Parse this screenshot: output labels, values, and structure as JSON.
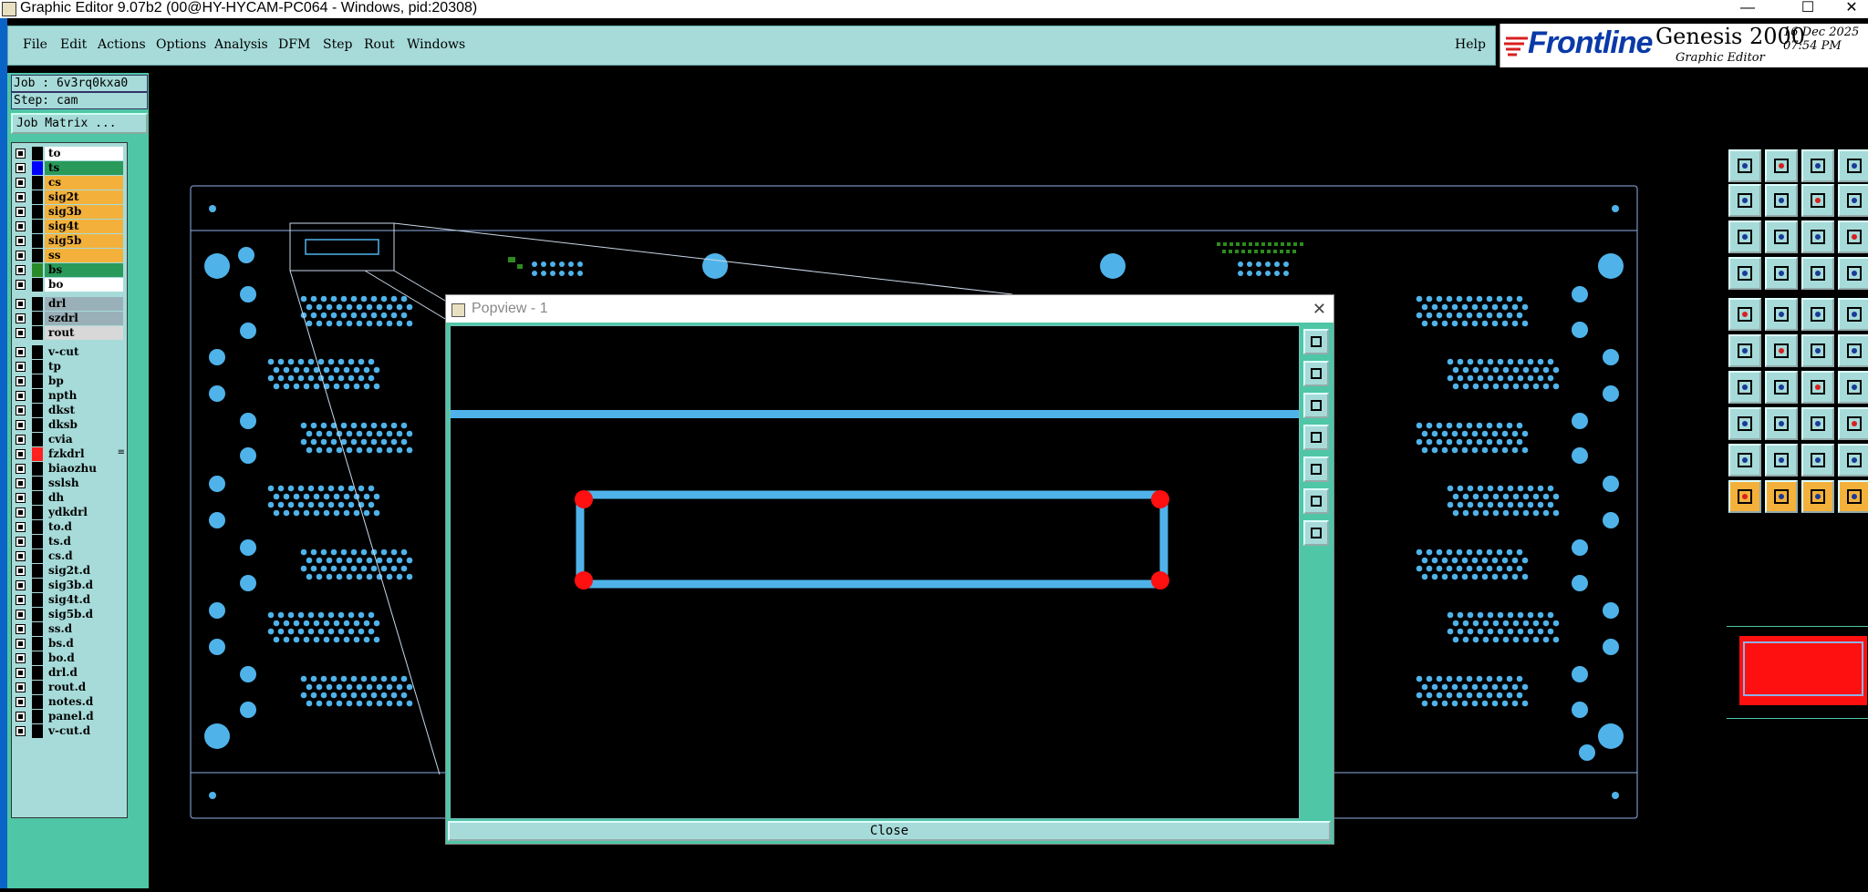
{
  "window": {
    "title": "Graphic Editor 9.07b2 (00@HY-HYCAM-PC064 - Windows, pid:20308)",
    "minimize": "—",
    "maximize": "☐",
    "close": "✕"
  },
  "menubar": {
    "items": [
      "File",
      "Edit",
      "Actions",
      "Options",
      "Analysis",
      "DFM",
      "Step",
      "Rout",
      "Windows"
    ],
    "help": "Help"
  },
  "logo": {
    "brand": "Frontline",
    "product": "Genesis 2000",
    "subtitle": "Graphic Editor",
    "date": "16 Dec 2025",
    "time": "07:54 PM"
  },
  "job": {
    "job_line": "Job : 6v3rq0kxa0",
    "step_line": "Step: cam",
    "matrix_button": "Job Matrix ..."
  },
  "layers": [
    {
      "name": "to",
      "swatch": "#000000",
      "bg": "#ffffff"
    },
    {
      "name": "ts",
      "swatch": "#0000ff",
      "bg": "#2a9a5a"
    },
    {
      "name": "cs",
      "swatch": "#000000",
      "bg": "#f3b13b"
    },
    {
      "name": "sig2t",
      "swatch": "#000000",
      "bg": "#f3b13b"
    },
    {
      "name": "sig3b",
      "swatch": "#000000",
      "bg": "#f3b13b"
    },
    {
      "name": "sig4t",
      "swatch": "#000000",
      "bg": "#f3b13b"
    },
    {
      "name": "sig5b",
      "swatch": "#000000",
      "bg": "#f3b13b"
    },
    {
      "name": "ss",
      "swatch": "#000000",
      "bg": "#f3b13b"
    },
    {
      "name": "bs",
      "swatch": "#2a8a2a",
      "bg": "#2a9a5a"
    },
    {
      "name": "bo",
      "swatch": "#000000",
      "bg": "#ffffff"
    },
    {
      "name": "drl",
      "swatch": "#000000",
      "bg": "#9ab0b8",
      "gap": true
    },
    {
      "name": "szdrl",
      "swatch": "#000000",
      "bg": "#9ab0b8"
    },
    {
      "name": "rout",
      "swatch": "#000000",
      "bg": "#d8d8d8"
    },
    {
      "name": "v-cut",
      "swatch": "#000000",
      "bg": "#a6dbd9",
      "gap": true
    },
    {
      "name": "tp",
      "swatch": "#000000",
      "bg": "#a6dbd9"
    },
    {
      "name": "bp",
      "swatch": "#000000",
      "bg": "#a6dbd9"
    },
    {
      "name": "npth",
      "swatch": "#000000",
      "bg": "#a6dbd9"
    },
    {
      "name": "dkst",
      "swatch": "#000000",
      "bg": "#a6dbd9"
    },
    {
      "name": "dksb",
      "swatch": "#000000",
      "bg": "#a6dbd9"
    },
    {
      "name": "cvia",
      "swatch": "#000000",
      "bg": "#a6dbd9"
    },
    {
      "name": "fzkdrl",
      "swatch": "#ff2020",
      "bg": "#a6dbd9",
      "mark": "≡"
    },
    {
      "name": "biaozhu",
      "swatch": "#000000",
      "bg": "#a6dbd9"
    },
    {
      "name": "sslsh",
      "swatch": "#000000",
      "bg": "#a6dbd9"
    },
    {
      "name": "dh",
      "swatch": "#000000",
      "bg": "#a6dbd9"
    },
    {
      "name": "ydkdrl",
      "swatch": "#000000",
      "bg": "#a6dbd9"
    },
    {
      "name": "to.d",
      "swatch": "#000000",
      "bg": "#a6dbd9"
    },
    {
      "name": "ts.d",
      "swatch": "#000000",
      "bg": "#a6dbd9"
    },
    {
      "name": "cs.d",
      "swatch": "#000000",
      "bg": "#a6dbd9"
    },
    {
      "name": "sig2t.d",
      "swatch": "#000000",
      "bg": "#a6dbd9"
    },
    {
      "name": "sig3b.d",
      "swatch": "#000000",
      "bg": "#a6dbd9"
    },
    {
      "name": "sig4t.d",
      "swatch": "#000000",
      "bg": "#a6dbd9"
    },
    {
      "name": "sig5b.d",
      "swatch": "#000000",
      "bg": "#a6dbd9"
    },
    {
      "name": "ss.d",
      "swatch": "#000000",
      "bg": "#a6dbd9"
    },
    {
      "name": "bs.d",
      "swatch": "#000000",
      "bg": "#a6dbd9"
    },
    {
      "name": "bo.d",
      "swatch": "#000000",
      "bg": "#a6dbd9"
    },
    {
      "name": "drl.d",
      "swatch": "#000000",
      "bg": "#a6dbd9"
    },
    {
      "name": "rout.d",
      "swatch": "#000000",
      "bg": "#a6dbd9"
    },
    {
      "name": "notes.d",
      "swatch": "#000000",
      "bg": "#a6dbd9"
    },
    {
      "name": "panel.d",
      "swatch": "#000000",
      "bg": "#a6dbd9"
    },
    {
      "name": "v-cut.d",
      "swatch": "#000000",
      "bg": "#a6dbd9"
    }
  ],
  "popup": {
    "title": "Popview - 1",
    "close_x": "✕",
    "close_button": "Close"
  },
  "colors": {
    "pad": "#4fb3ea",
    "highlight": "#ff1010",
    "green_copper": "#2e8b1e",
    "teal": "#4fc6a6",
    "panel": "#a6dbd9",
    "outline": "#8fb0e8"
  },
  "right_tools": [
    "open-job-icon",
    "save-icon",
    "home-icon",
    "window-icon",
    "step-in-icon",
    "step-out-icon",
    "swap-icon",
    "split-icon",
    "zoom-fit-icon",
    "zoom-center-icon",
    "ratio-icon",
    "help-icon",
    "measure-icon",
    "probe-icon",
    "layer-swap-icon",
    "layer-list-icon",
    "pad-icon",
    "snap-icon",
    "line-style-icon",
    "circle-icon",
    "node-icon",
    "cross-icon",
    "point-icon",
    "connect-icon",
    "angle-icon",
    "line-icon",
    "arc-icon",
    "function-icon",
    "move-icon",
    "minus-icon",
    "resize-icon",
    "copy-icon",
    "tri-a-icon",
    "tri-b-icon",
    "tri-c-icon",
    "tri-d-icon",
    "select-icon",
    "select-box-icon",
    "select-circle-icon",
    "select-more-icon"
  ],
  "popview_tools": [
    "zoom-icon",
    "page-up-icon",
    "page-down-icon",
    "left-icon",
    "right-icon",
    "fit-icon",
    "center-icon"
  ]
}
